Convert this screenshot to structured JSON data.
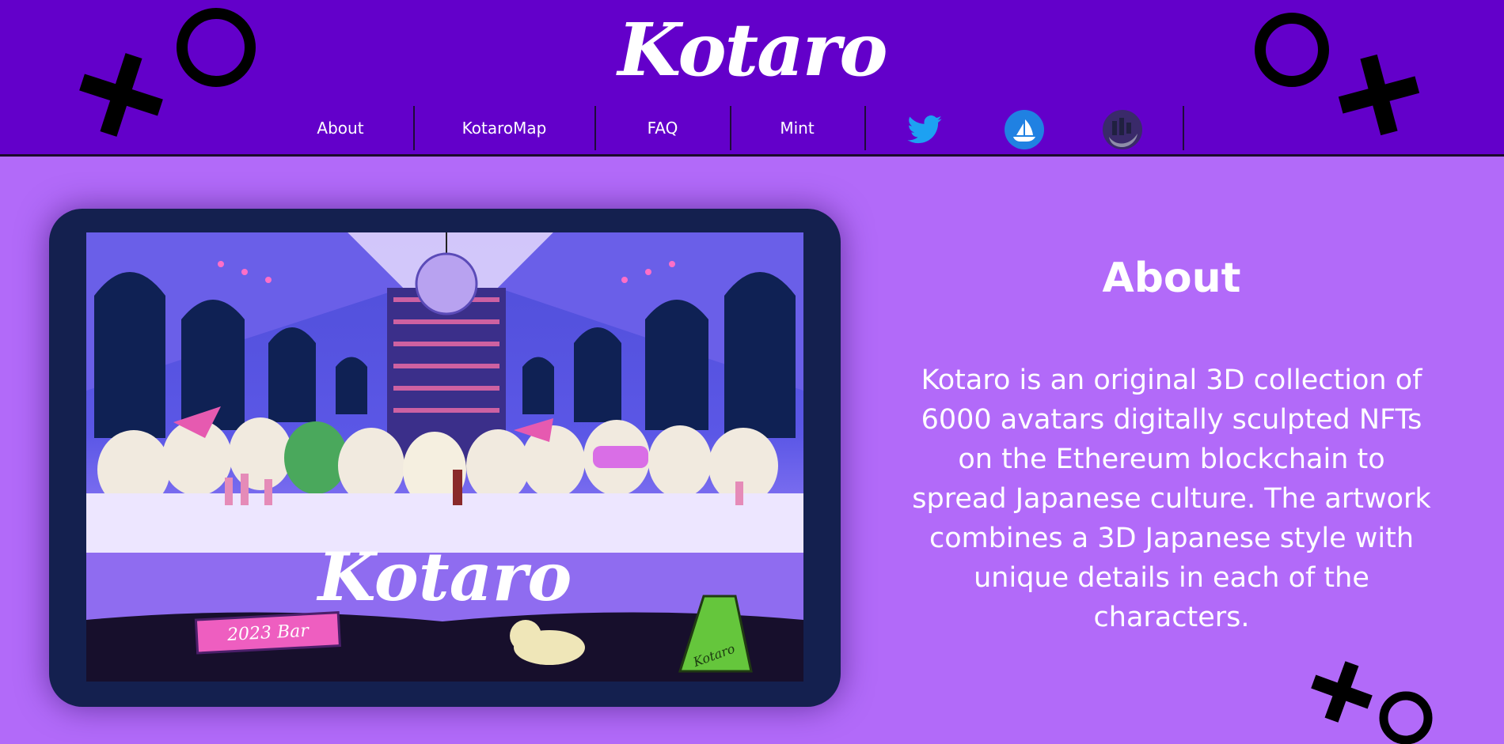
{
  "brand": {
    "logo_text": "Kotaro"
  },
  "nav": {
    "items": [
      {
        "label": "About"
      },
      {
        "label": "KotaroMap"
      },
      {
        "label": "FAQ"
      },
      {
        "label": "Mint"
      }
    ],
    "social": [
      {
        "icon": "twitter-icon",
        "color": "#1da1f2"
      },
      {
        "icon": "opensea-icon",
        "color": "#2081e2"
      },
      {
        "icon": "looksrare-icon",
        "color": "#7b7b9a"
      }
    ]
  },
  "hero": {
    "artwork_text": "Kotaro",
    "sign_text": "Kotaro",
    "bar_sign_text": "2023 Bar"
  },
  "about": {
    "title": "About",
    "body": "Kotaro is an original 3D collection of 6000 avatars digitally sculpted NFTs on the Ethereum blockchain to spread Japanese culture. The artwork combines a 3D Japanese style with unique details in each of the characters."
  },
  "colors": {
    "header_bg": "#6300ca",
    "page_bg": "#b26af9",
    "frame": "#14204f",
    "deco": "#000000"
  }
}
